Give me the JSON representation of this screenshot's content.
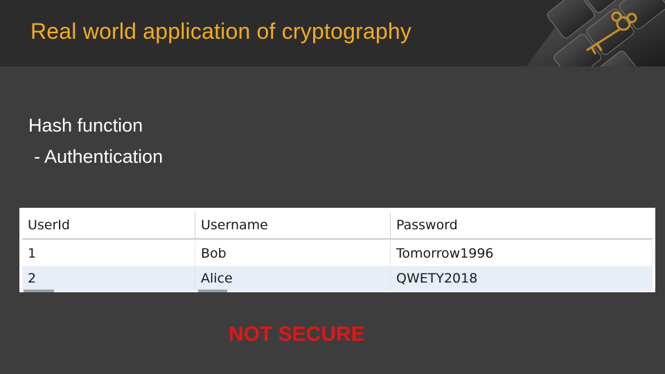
{
  "slide": {
    "title": "Real world application of cryptography",
    "lines": [
      "Hash function",
      " - Authentication"
    ],
    "warning": "NOT SECURE"
  },
  "table": {
    "columns": [
      "UserId",
      "Username",
      "Password"
    ],
    "rows": [
      [
        "1",
        "Bob",
        "Tomorrow1996"
      ],
      [
        "2",
        "Alice",
        "QWETY2018"
      ]
    ]
  },
  "colors": {
    "title": "#f2ad1e",
    "warning": "#e01717",
    "background": "#3e3d3e",
    "header_band": "#2d2c2d"
  },
  "icons": [
    "keyboard-key-image",
    "golden-key-icon"
  ]
}
